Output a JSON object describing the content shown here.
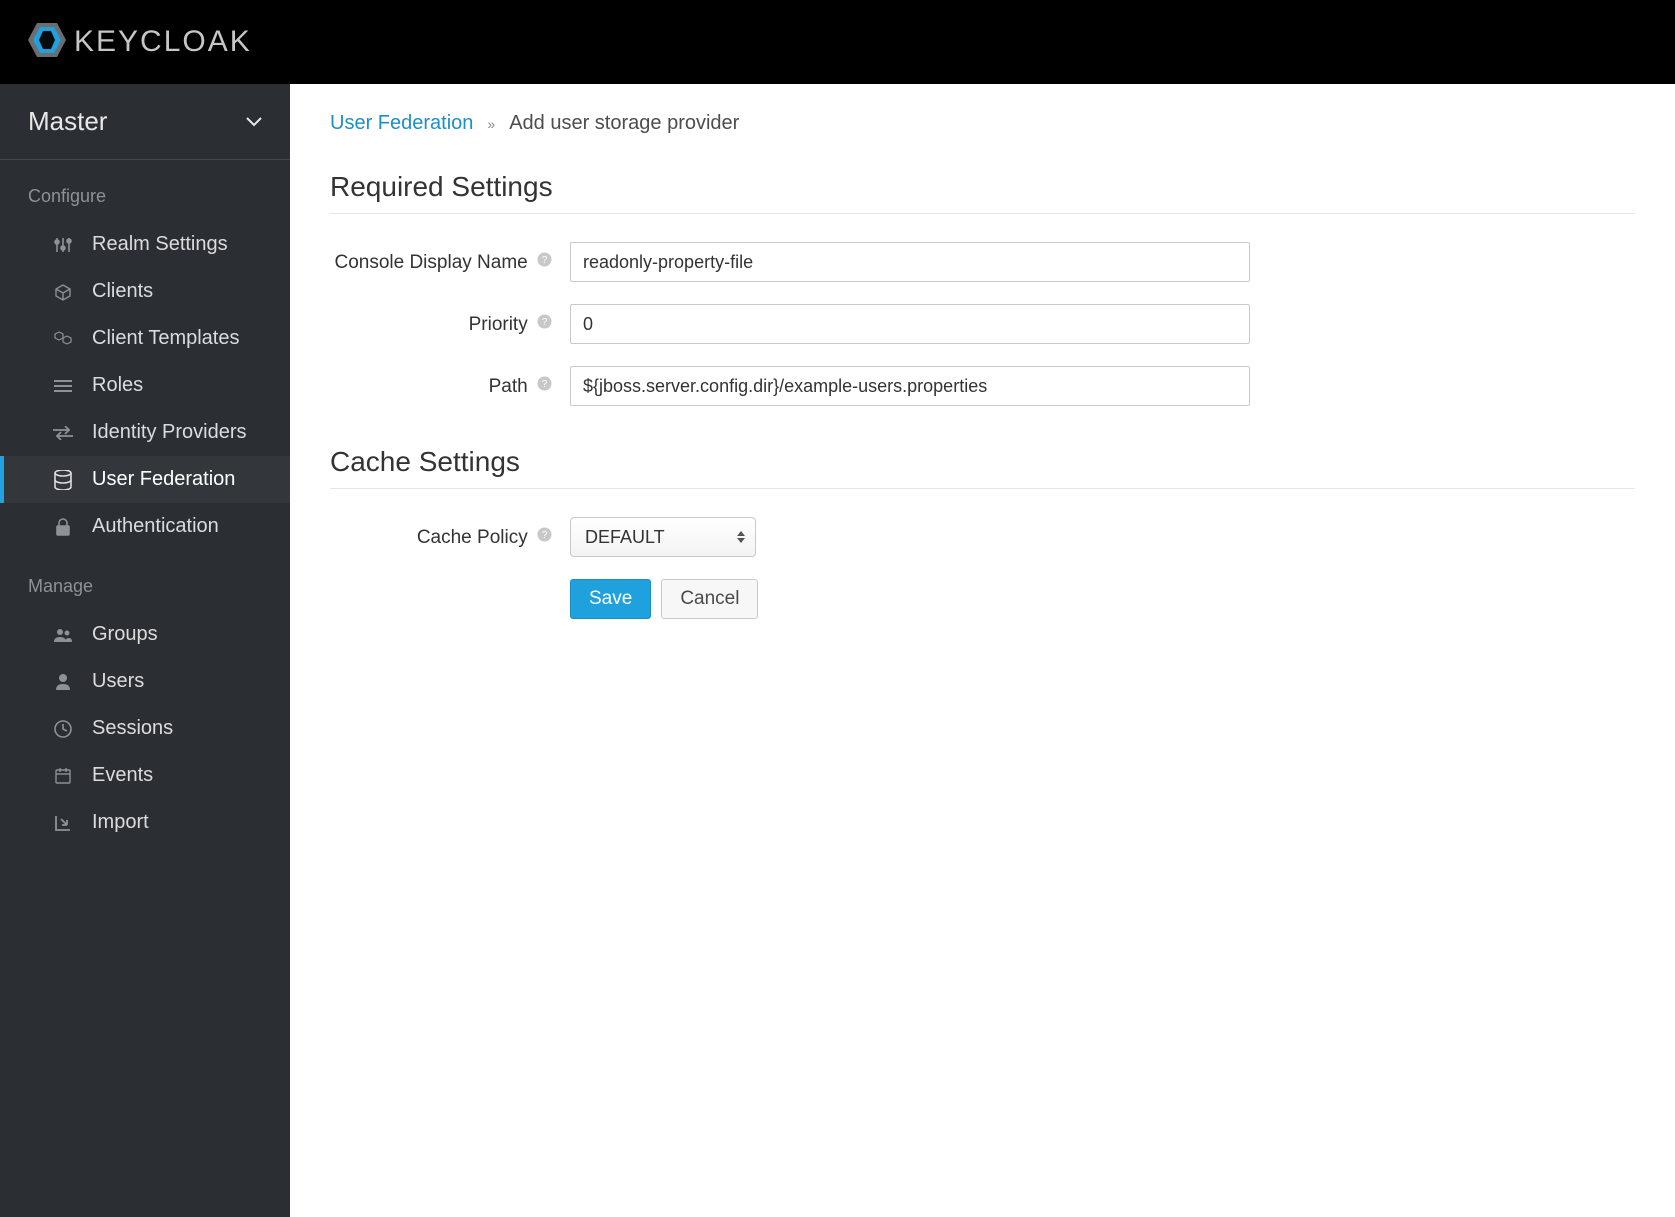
{
  "brand": "KEYCLOAK",
  "realm_selector": {
    "label": "Master"
  },
  "sidebar": {
    "configure_title": "Configure",
    "manage_title": "Manage",
    "configure_items": [
      {
        "label": "Realm Settings",
        "icon": "sliders"
      },
      {
        "label": "Clients",
        "icon": "cube"
      },
      {
        "label": "Client Templates",
        "icon": "cubes"
      },
      {
        "label": "Roles",
        "icon": "list"
      },
      {
        "label": "Identity Providers",
        "icon": "exchange"
      },
      {
        "label": "User Federation",
        "icon": "database",
        "active": true
      },
      {
        "label": "Authentication",
        "icon": "lock"
      }
    ],
    "manage_items": [
      {
        "label": "Groups",
        "icon": "group"
      },
      {
        "label": "Users",
        "icon": "user"
      },
      {
        "label": "Sessions",
        "icon": "clock"
      },
      {
        "label": "Events",
        "icon": "calendar"
      },
      {
        "label": "Import",
        "icon": "import"
      }
    ]
  },
  "breadcrumb": {
    "parent": "User Federation",
    "current": "Add user storage provider"
  },
  "sections": {
    "required": "Required Settings",
    "cache": "Cache Settings"
  },
  "form": {
    "console_display_name": {
      "label": "Console Display Name",
      "value": "readonly-property-file"
    },
    "priority": {
      "label": "Priority",
      "value": "0"
    },
    "path": {
      "label": "Path",
      "value": "${jboss.server.config.dir}/example-users.properties"
    },
    "cache_policy": {
      "label": "Cache Policy",
      "value": "DEFAULT"
    }
  },
  "buttons": {
    "save": "Save",
    "cancel": "Cancel"
  }
}
